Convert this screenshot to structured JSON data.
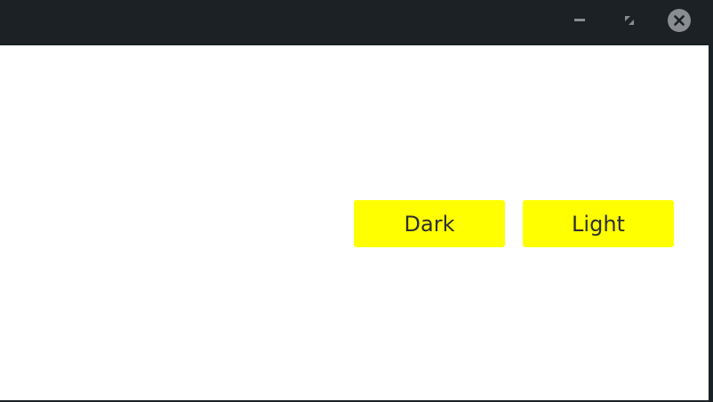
{
  "titlebar": {
    "controls": {
      "minimize_icon": "minimize-icon",
      "maximize_icon": "restore-icon",
      "close_icon": "close-icon"
    },
    "background": "#1b2125",
    "icon_color": "#8a8d90"
  },
  "main": {
    "background": "#ffffff",
    "buttons": [
      {
        "label": "Dark",
        "background": "#ffff00"
      },
      {
        "label": "Light",
        "background": "#ffff00"
      }
    ]
  }
}
